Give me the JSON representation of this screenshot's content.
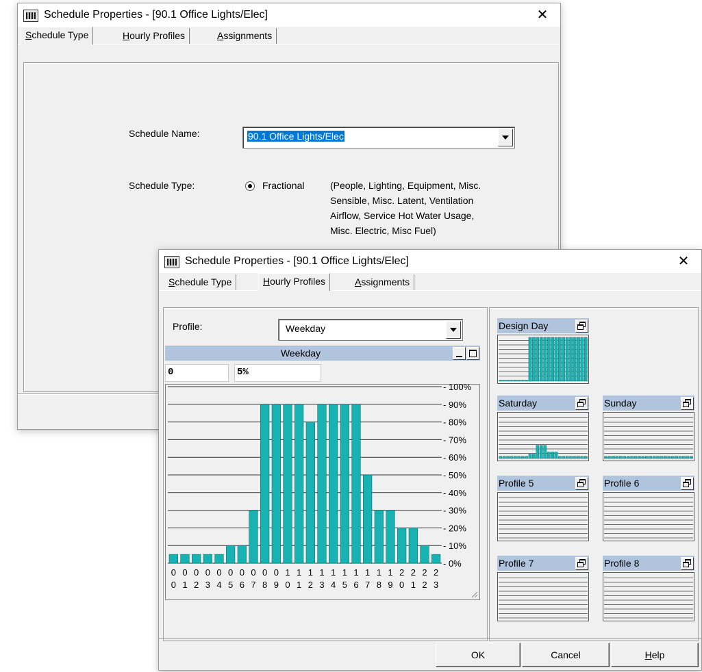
{
  "back_window": {
    "title": "Schedule Properties - [90.1 Office Lights/Elec]",
    "close_glyph": "✕",
    "tabs": [
      {
        "pre": "",
        "key": "S",
        "post": "chedule Type"
      },
      {
        "pre": "",
        "key": "H",
        "post": "ourly Profiles"
      },
      {
        "pre": "",
        "key": "A",
        "post": "ssignments"
      }
    ],
    "schedule_name_label": "Schedule Name:",
    "schedule_name_value": "90.1 Office Lights/Elec",
    "schedule_type_label": "Schedule Type:",
    "fractional_label": "Fractional",
    "fractional_desc": [
      "(People, Lighting, Equipment, Misc.",
      "Sensible, Misc. Latent, Ventilation",
      "Airflow, Service Hot Water Usage,",
      "Misc. Electric, Misc Fuel)"
    ]
  },
  "front_window": {
    "title": "Schedule Properties - [90.1 Office Lights/Elec]",
    "close_glyph": "✕",
    "tabs": [
      {
        "pre": "",
        "key": "S",
        "post": "chedule Type"
      },
      {
        "pre": "",
        "key": "H",
        "post": "ourly Profiles"
      },
      {
        "pre": "",
        "key": "A",
        "post": "ssignments"
      }
    ],
    "profile_label": "Profile:",
    "profile_value": "Weekday",
    "chart_header": "Weekday",
    "hour_field": "0",
    "value_field": "5%",
    "buttons": {
      "ok": "OK",
      "cancel": "Cancel",
      "help_key": "H",
      "help_post": "elp"
    },
    "thumbnails": [
      {
        "name": "Design Day",
        "values": [
          0,
          0,
          0,
          0,
          0,
          0,
          0,
          0,
          100,
          100,
          100,
          100,
          100,
          100,
          100,
          100,
          100,
          100,
          100,
          100,
          100,
          100,
          100,
          100
        ]
      },
      {
        "name": "Saturday",
        "values": [
          5,
          5,
          5,
          5,
          5,
          5,
          5,
          5,
          10,
          10,
          30,
          30,
          30,
          15,
          15,
          15,
          5,
          5,
          5,
          5,
          5,
          5,
          5,
          5
        ]
      },
      {
        "name": "Sunday",
        "values": [
          5,
          5,
          5,
          5,
          5,
          5,
          5,
          5,
          5,
          5,
          5,
          5,
          5,
          5,
          5,
          5,
          5,
          5,
          5,
          5,
          5,
          5,
          5,
          5
        ]
      },
      {
        "name": "Profile 5",
        "values": []
      },
      {
        "name": "Profile 6",
        "values": []
      },
      {
        "name": "Profile 7",
        "values": []
      },
      {
        "name": "Profile 8",
        "values": []
      }
    ]
  },
  "colors": {
    "bar": "#19b2b2",
    "header": "#b0c4de",
    "selection": "#0078d7"
  },
  "chart_data": {
    "type": "bar",
    "categories": [
      "00",
      "01",
      "02",
      "03",
      "04",
      "05",
      "06",
      "07",
      "08",
      "09",
      "10",
      "11",
      "12",
      "13",
      "14",
      "15",
      "16",
      "17",
      "18",
      "19",
      "20",
      "21",
      "22",
      "23"
    ],
    "values": [
      5,
      5,
      5,
      5,
      5,
      10,
      10,
      30,
      90,
      90,
      90,
      90,
      80,
      90,
      90,
      90,
      90,
      50,
      30,
      30,
      20,
      20,
      10,
      5
    ],
    "y_ticks": [
      "- 100%",
      "- 90%",
      "- 80%",
      "- 70%",
      "- 60%",
      "- 50%",
      "- 40%",
      "- 30%",
      "- 20%",
      "- 10%",
      "- 0%"
    ],
    "ylim": [
      0,
      100
    ],
    "grid": true
  }
}
